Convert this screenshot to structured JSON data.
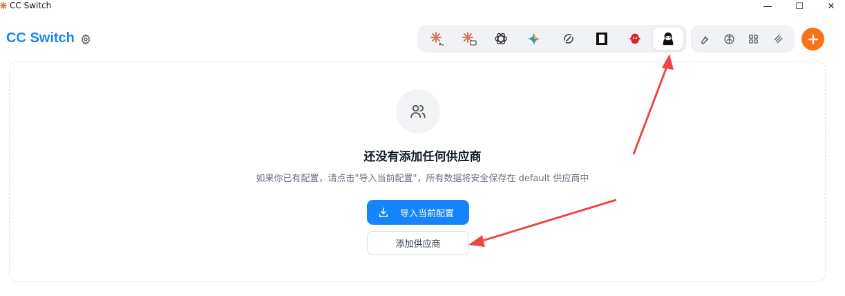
{
  "window": {
    "title": "CC Switch",
    "minimize_glyph": "—",
    "maximize_glyph": "☐",
    "close_glyph": "✕"
  },
  "header": {
    "app_title": "CC Switch",
    "settings_icon": "gear-icon"
  },
  "tools": [
    {
      "icon": "claude-terminal-icon",
      "active": false
    },
    {
      "icon": "claude-desktop-icon",
      "active": false
    },
    {
      "icon": "openai-icon",
      "active": false
    },
    {
      "icon": "gemini-icon",
      "active": false
    },
    {
      "icon": "refresh-loop-icon",
      "active": false
    },
    {
      "icon": "black-square-icon",
      "active": false
    },
    {
      "icon": "red-creature-icon",
      "active": false
    },
    {
      "icon": "character-icon",
      "active": true
    }
  ],
  "utilities": [
    {
      "icon": "wrench-icon"
    },
    {
      "icon": "brain-icon"
    },
    {
      "icon": "grid-icon"
    },
    {
      "icon": "layers-icon"
    }
  ],
  "add_button_icon": "plus-icon",
  "empty_state": {
    "icon": "users-icon",
    "title": "还没有添加任何供应商",
    "description": "如果你已有配置，请点击\"导入当前配置\"，所有数据将安全保存在 default 供应商中",
    "import_button": "导入当前配置",
    "add_button": "添加供应商"
  },
  "colors": {
    "accent": "#1a86f0",
    "primary_button": "#1684fa",
    "fab": "#f97316",
    "arrow": "#f04545"
  }
}
